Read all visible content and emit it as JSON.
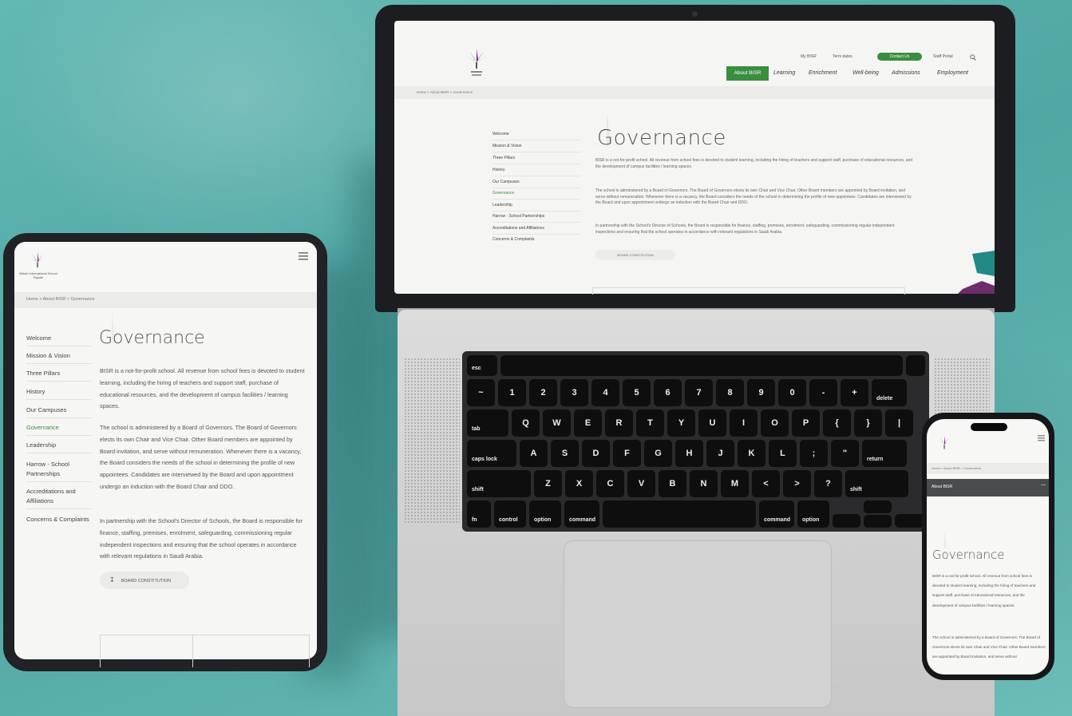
{
  "laptop": {
    "util_links": [
      "My BISR",
      "Term dates",
      "Staff Portal"
    ],
    "contact_label": "Contact Us",
    "nav": [
      "About BISR",
      "Learning",
      "Enrichment",
      "Well-being",
      "Admissions",
      "Employment"
    ],
    "breadcrumb": "Home  >  About BISR  >  Governance",
    "sidebar": [
      "Welcome",
      "Mission & Vision",
      "Three Pillars",
      "History",
      "Our Campuses",
      "Governance",
      "Leadership",
      "Harrow - School Partnerships",
      "Accreditations and Affiliations",
      "Concerns & Complaints"
    ],
    "title": "Governance",
    "paragraphs": [
      "BISR is a not-for-profit school. All revenue from school fees is devoted to student learning, including the hiring of teachers and support staff, purchase of educational resources, and the development of campus facilities / learning spaces.",
      "The school is administered by a Board of Governors. The Board of Governors elects its own Chair and Vice Chair. Other Board members are appointed by Board invitation, and serve without remuneration. Whenever there is a vacancy, the Board considers the needs of the school in determining the profile of new appointees. Candidates are interviewed by the Board and upon appointment undergo an induction with the Board Chair and DDO.",
      "In partnership with the School's Director of Schools, the Board is responsible for finance, staffing, premises, enrolment, safeguarding, commissioning regular independent inspections and ensuring that the school operates in accordance with relevant regulations in Saudi Arabia."
    ],
    "button_label": "BOARD CONSTITUTION"
  },
  "keyboard": {
    "row0": [
      "esc"
    ],
    "row1": [
      "~",
      "1",
      "2",
      "3",
      "4",
      "5",
      "6",
      "7",
      "8",
      "9",
      "0",
      "-",
      "+",
      "delete"
    ],
    "row1_top": [
      "`",
      "!",
      "@",
      "#",
      "$",
      "%",
      "^",
      "&",
      "*",
      "(",
      ")",
      "_",
      "="
    ],
    "row2": [
      "tab",
      "Q",
      "W",
      "E",
      "R",
      "T",
      "Y",
      "U",
      "I",
      "O",
      "P",
      "{",
      "}",
      "|"
    ],
    "row3": [
      "caps lock",
      "A",
      "S",
      "D",
      "F",
      "G",
      "H",
      "J",
      "K",
      "L",
      ";",
      "\"",
      "return"
    ],
    "row4": [
      "shift",
      "Z",
      "X",
      "C",
      "V",
      "B",
      "N",
      "M",
      "<",
      ">",
      "?",
      "shift"
    ],
    "row5": [
      "fn",
      "control",
      "option",
      "command",
      "command",
      "option"
    ]
  },
  "tablet": {
    "school_name": "British International School Riyadh",
    "breadcrumb": "Home  >  About BISR  >  Governance",
    "sidebar": [
      "Welcome",
      "Mission & Vision",
      "Three Pillars",
      "History",
      "Our Campuses",
      "Governance",
      "Leadership",
      "Harrow - School Partnerships",
      "Accreditations and Affiliations",
      "Concerns & Complaints"
    ],
    "active_item": "Governance",
    "title": "Governance",
    "paragraphs": [
      "BISR is a not-for-profit school. All revenue from school fees is devoted to student learning, including the hiring of teachers and support staff, purchase of educational resources, and the development of campus facilities / learning spaces.",
      "The school is administered by a Board of Governors. The Board of Governors elects its own Chair and Vice Chair. Other Board members are appointed by Board invitation, and serve without remuneration. Whenever there is a vacancy, the Board considers the needs of the school in determining the profile of new appointees. Candidates are interviewed by the Board and upon appointment undergo an induction with the Board Chair and DDO.",
      "In partnership with the School's Director of Schools, the Board is responsible for finance, staffing, premises, enrolment, safeguarding, commissioning regular independent inspections and ensuring that the school operates in accordance with relevant regulations in Saudi Arabia."
    ],
    "button_label": "BOARD CONSTITUTION"
  },
  "phone": {
    "breadcrumb": "Home  >  About BISR  >  Governance",
    "section_bar": "About BISR",
    "title": "Governance",
    "paragraphs": [
      "BISR is a not-for-profit school. All revenue from school fees is devoted to student learning, including the hiring of teachers and support staff, purchase of educational resources, and the development of campus facilities / learning spaces.",
      "The school is administered by a Board of Governors. The Board of Governors elects its own Chair and Vice Chair. Other Board members are appointed by Board invitation, and serve without"
    ]
  },
  "colors": {
    "background": "#5db1ad",
    "accent_green": "#3a8e3f",
    "device_frame": "#1b1d20"
  }
}
